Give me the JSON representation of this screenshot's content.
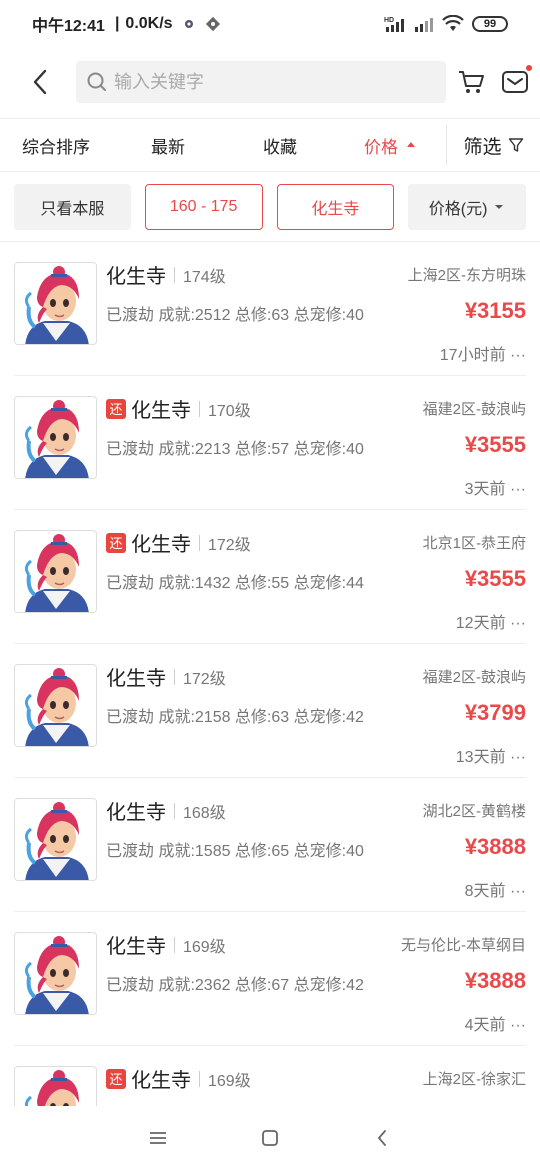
{
  "status_bar": {
    "time": "中午12:41",
    "net_speed": "0.0K/s",
    "battery": "99"
  },
  "search": {
    "placeholder": "输入关键字"
  },
  "sort_bar": {
    "comprehensive": "综合排序",
    "newest": "最新",
    "favorites": "收藏",
    "price": "价格",
    "filter": "筛选"
  },
  "filters": {
    "server_only": "只看本服",
    "level_range": "160 - 175",
    "school": "化生寺",
    "price_sort": "价格(元)"
  },
  "badge_label": "还",
  "listings": [
    {
      "badge": false,
      "name": "化生寺",
      "level": "174级",
      "server": "上海2区-东方明珠",
      "stats": "已渡劫 成就:2512 总修:63 总宠修:40",
      "price": "¥3155",
      "time": "17小时前 ···"
    },
    {
      "badge": true,
      "name": "化生寺",
      "level": "170级",
      "server": "福建2区-鼓浪屿",
      "stats": "已渡劫 成就:2213 总修:57 总宠修:40",
      "price": "¥3555",
      "time": "3天前 ···"
    },
    {
      "badge": true,
      "name": "化生寺",
      "level": "172级",
      "server": "北京1区-恭王府",
      "stats": "已渡劫 成就:1432 总修:55 总宠修:44",
      "price": "¥3555",
      "time": "12天前 ···"
    },
    {
      "badge": false,
      "name": "化生寺",
      "level": "172级",
      "server": "福建2区-鼓浪屿",
      "stats": "已渡劫 成就:2158 总修:63 总宠修:42",
      "price": "¥3799",
      "time": "13天前 ···"
    },
    {
      "badge": false,
      "name": "化生寺",
      "level": "168级",
      "server": "湖北2区-黄鹤楼",
      "stats": "已渡劫 成就:1585 总修:65 总宠修:40",
      "price": "¥3888",
      "time": "8天前 ···"
    },
    {
      "badge": false,
      "name": "化生寺",
      "level": "169级",
      "server": "无与伦比-本草纲目",
      "stats": "已渡劫 成就:2362 总修:67 总宠修:42",
      "price": "¥3888",
      "time": "4天前 ···"
    },
    {
      "badge": true,
      "name": "化生寺",
      "level": "169级",
      "server": "上海2区-徐家汇",
      "stats": "",
      "price": "",
      "time": ""
    }
  ]
}
